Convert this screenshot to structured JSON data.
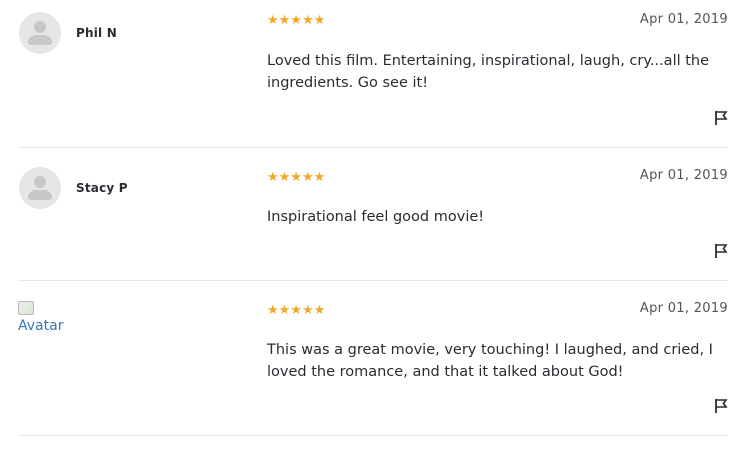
{
  "colors": {
    "star": "#f5a623",
    "divider": "#e9e9e9",
    "text": "#2a2c32",
    "date": "#545454",
    "avatar_bg": "#e6e6e6"
  },
  "reviews": [
    {
      "username": "Phil N",
      "rating": "★★★★★",
      "date": "Apr 01, 2019",
      "text": "Loved this film. Entertaining, inspirational, laugh, cry...all the ingredients. Go see it!",
      "avatar": "default-avatar-icon"
    },
    {
      "username": "Stacy P",
      "rating": "★★★★★",
      "date": "Apr 01, 2019",
      "text": "Inspirational feel good movie!",
      "avatar": "default-avatar-icon"
    },
    {
      "username": "",
      "avatar_alt": "Avatar",
      "rating": "★★★★★",
      "date": "Apr 01, 2019",
      "text": "This was a great movie, very touching! I laughed, and cried, I loved the romance, and that it talked about God!",
      "avatar": "broken-image-icon"
    }
  ]
}
